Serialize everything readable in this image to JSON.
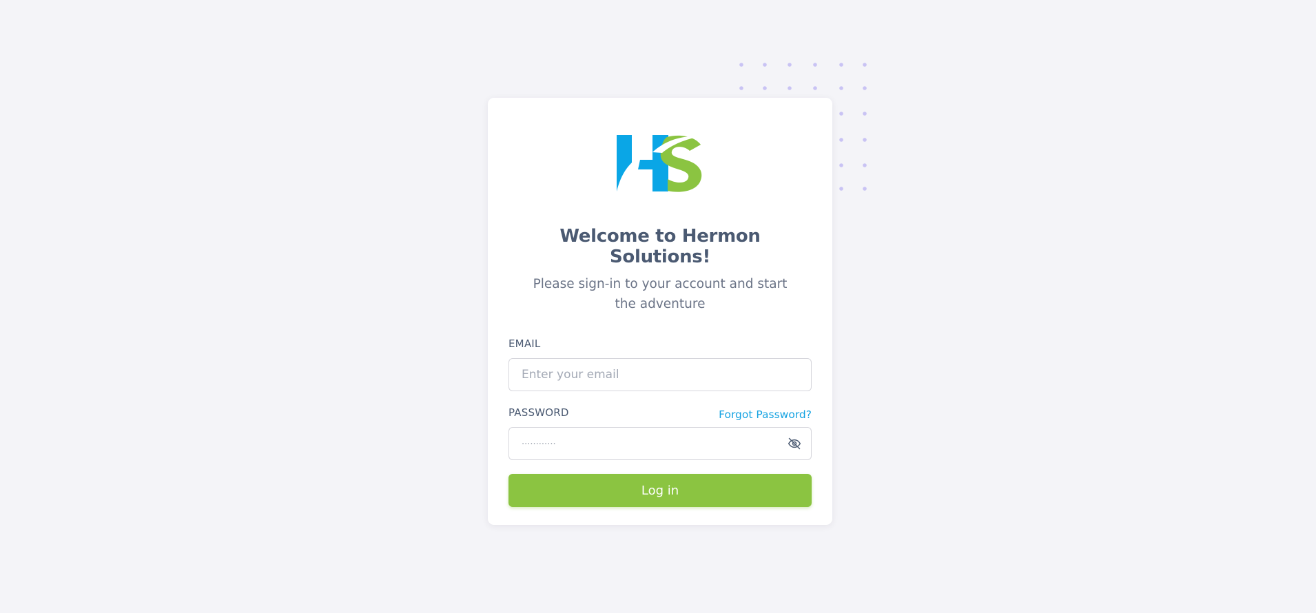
{
  "brand": {
    "logo": "HS",
    "colors": {
      "blue": "#0aa6e6",
      "green": "#8bc441"
    }
  },
  "header": {
    "title": "Welcome to Hermon Solutions!",
    "subtitle": "Please sign-in to your account and start the adventure"
  },
  "form": {
    "email": {
      "label": "EMAIL",
      "placeholder": "Enter your email",
      "value": ""
    },
    "password": {
      "label": "PASSWORD",
      "placeholder": "············",
      "value": "",
      "toggle_icon": "eye-off-icon"
    },
    "forgot_password": "Forgot Password?",
    "submit_label": "Log in"
  },
  "theme": {
    "background": "#f4f4f8",
    "accent": "#8bc441",
    "link": "#16a3e2",
    "dots": "#c9c3f4"
  }
}
